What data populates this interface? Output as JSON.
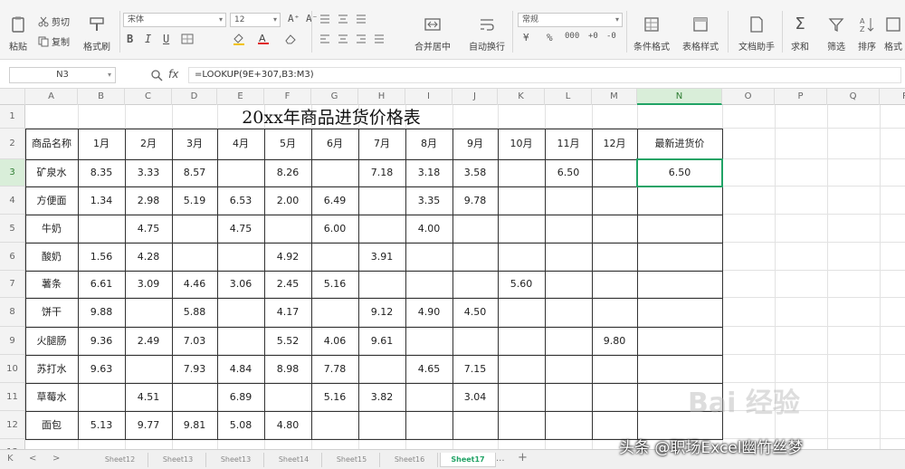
{
  "ribbon": {
    "cut": "剪切",
    "paste": "粘贴",
    "copy": "复制",
    "format_painter": "格式刷",
    "font_name": "宋体",
    "font_size": "12",
    "bold": "B",
    "italic": "I",
    "underline": "U",
    "grow": "A⁺",
    "shrink": "A⁻",
    "merge_center": "合并居中",
    "wrap": "自动换行",
    "number_format": "常规",
    "percent": "%",
    "conditional": "条件格式",
    "table_style": "表格样式",
    "doc_helper": "文档助手",
    "sum": "求和",
    "filter": "筛选",
    "sort": "排序",
    "format": "格式"
  },
  "formula_bar": {
    "cell_ref": "N3",
    "fx": "fx",
    "formula": "=LOOKUP(9E+307,B3:M3)"
  },
  "columns": [
    "A",
    "B",
    "C",
    "D",
    "E",
    "F",
    "G",
    "H",
    "I",
    "J",
    "K",
    "L",
    "M",
    "N",
    "O",
    "P",
    "Q",
    "R"
  ],
  "selected_column": "N",
  "rows": [
    "1",
    "2",
    "3",
    "4",
    "5",
    "6",
    "7",
    "8",
    "9",
    "10",
    "11",
    "12",
    "13"
  ],
  "selected_row": "3",
  "sheet": {
    "title": "20xx年商品进货价格表",
    "headers": [
      "商品名称",
      "1月",
      "2月",
      "3月",
      "4月",
      "5月",
      "6月",
      "7月",
      "8月",
      "9月",
      "10月",
      "11月",
      "12月",
      "最新进货价"
    ],
    "data": [
      [
        "矿泉水",
        "8.35",
        "3.33",
        "8.57",
        "",
        "8.26",
        "",
        "7.18",
        "3.18",
        "3.58",
        "",
        "6.50",
        "",
        "6.50"
      ],
      [
        "方便面",
        "1.34",
        "2.98",
        "5.19",
        "6.53",
        "2.00",
        "6.49",
        "",
        "3.35",
        "9.78",
        "",
        "",
        "",
        ""
      ],
      [
        "牛奶",
        "",
        "4.75",
        "",
        "4.75",
        "",
        "6.00",
        "",
        "4.00",
        "",
        "",
        "",
        "",
        ""
      ],
      [
        "酸奶",
        "1.56",
        "4.28",
        "",
        "",
        "4.92",
        "",
        "3.91",
        "",
        "",
        "",
        "",
        "",
        ""
      ],
      [
        "薯条",
        "6.61",
        "3.09",
        "4.46",
        "3.06",
        "2.45",
        "5.16",
        "",
        "",
        "",
        "5.60",
        "",
        "",
        ""
      ],
      [
        "饼干",
        "9.88",
        "",
        "5.88",
        "",
        "4.17",
        "",
        "9.12",
        "4.90",
        "4.50",
        "",
        "",
        "",
        ""
      ],
      [
        "火腿肠",
        "9.36",
        "2.49",
        "7.03",
        "",
        "5.52",
        "4.06",
        "9.61",
        "",
        "",
        "",
        "",
        "9.80",
        ""
      ],
      [
        "苏打水",
        "9.63",
        "",
        "7.93",
        "4.84",
        "8.98",
        "7.78",
        "",
        "4.65",
        "7.15",
        "",
        "",
        "",
        ""
      ],
      [
        "草莓水",
        "",
        "4.51",
        "",
        "6.89",
        "",
        "5.16",
        "3.82",
        "",
        "3.04",
        "",
        "",
        "",
        ""
      ],
      [
        "面包",
        "5.13",
        "9.77",
        "9.81",
        "5.08",
        "4.80",
        "",
        "",
        "",
        "",
        "",
        "",
        "",
        ""
      ]
    ]
  },
  "tabs": {
    "sheets": [
      "Sheet12",
      "Sheet13",
      "Sheet13",
      "Sheet14",
      "Sheet15",
      "Sheet16",
      "Sheet17"
    ],
    "active_index": 6,
    "more": "...",
    "add": "+"
  },
  "watermark": "头条 @职场Excel幽竹丝梦",
  "baidu_mark": "Bai 经验",
  "colors": {
    "accent": "#21a366",
    "selected_header_bg": "#d9eed9"
  }
}
